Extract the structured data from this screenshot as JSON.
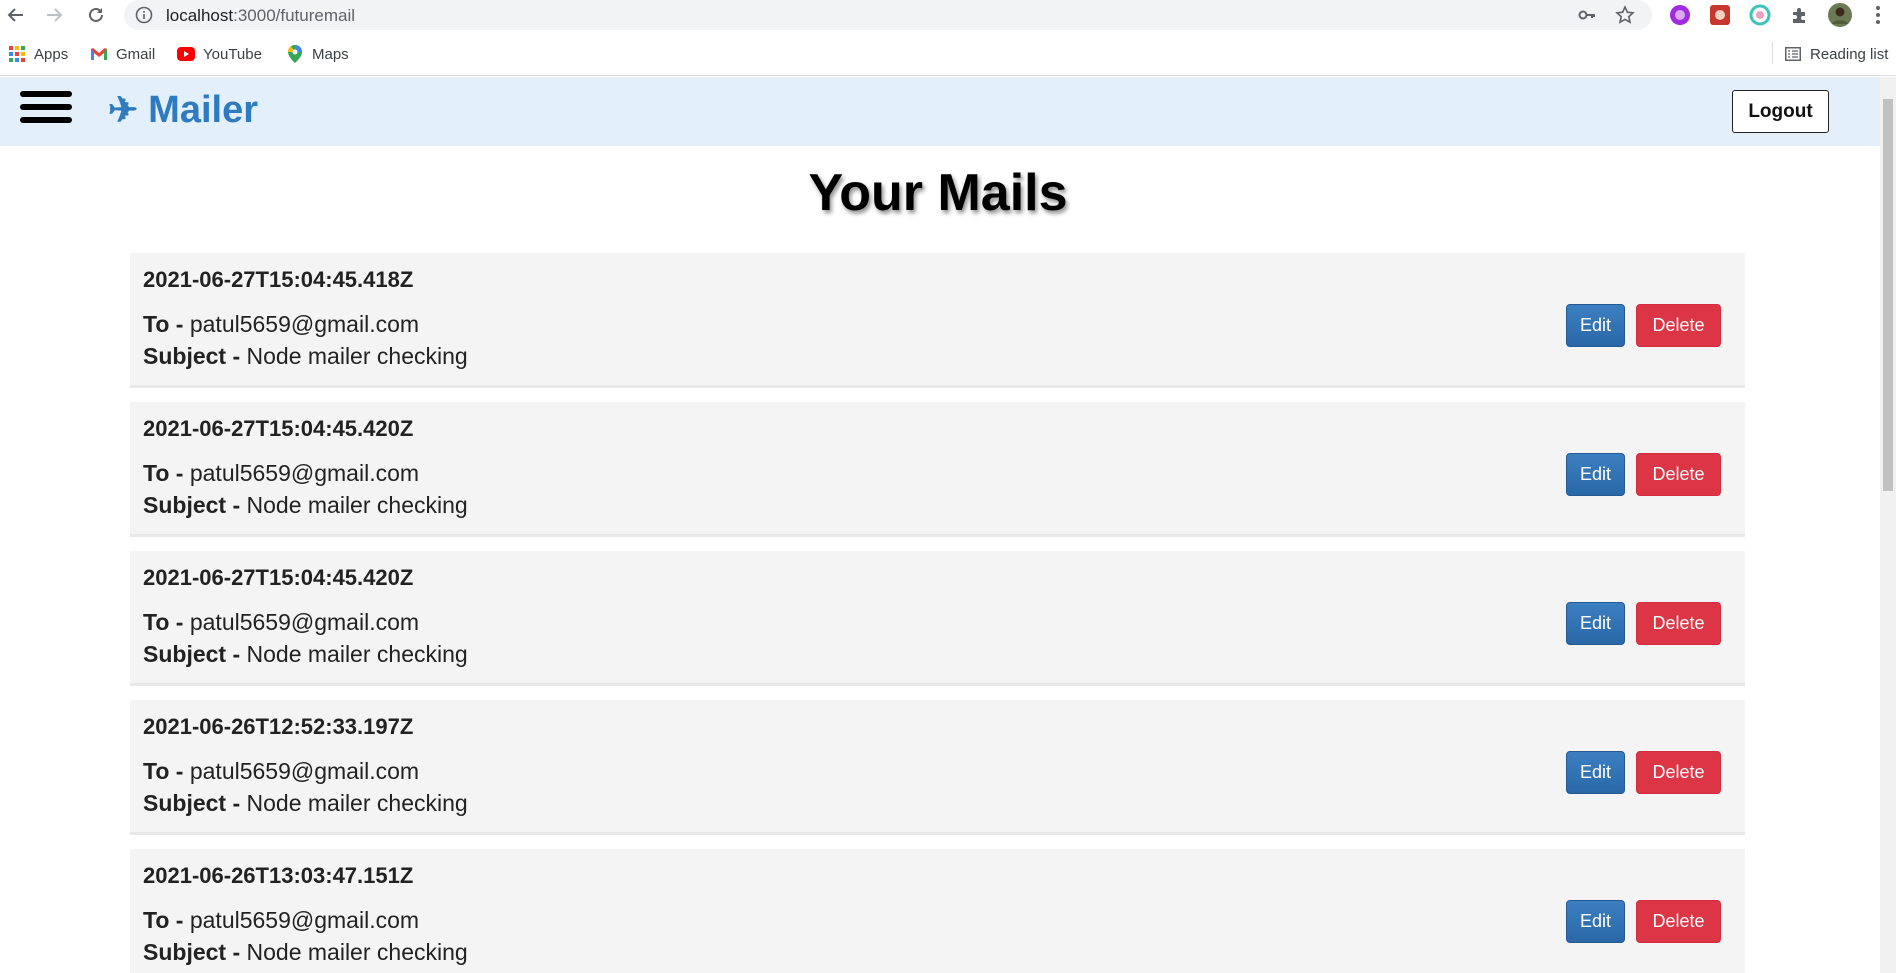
{
  "browser": {
    "url_host": "localhost",
    "url_path": ":3000/futuremail",
    "bookmarks": [
      {
        "label": "Apps",
        "icon": "apps-grid-icon"
      },
      {
        "label": "Gmail",
        "icon": "gmail-icon"
      },
      {
        "label": "YouTube",
        "icon": "youtube-icon"
      },
      {
        "label": "Maps",
        "icon": "maps-icon"
      }
    ],
    "reading_list": "Reading list"
  },
  "header": {
    "brand_icon": "✈",
    "brand": "Mailer",
    "logout_label": "Logout"
  },
  "page_title": "Your Mails",
  "mail_labels": {
    "to": "To -",
    "subject": "Subject -",
    "edit": "Edit",
    "delete": "Delete"
  },
  "mails": [
    {
      "date": "2021-06-27T15:04:45.418Z",
      "to": "patul5659@gmail.com",
      "subject": "Node mailer checking"
    },
    {
      "date": "2021-06-27T15:04:45.420Z",
      "to": "patul5659@gmail.com",
      "subject": "Node mailer checking"
    },
    {
      "date": "2021-06-27T15:04:45.420Z",
      "to": "patul5659@gmail.com",
      "subject": "Node mailer checking"
    },
    {
      "date": "2021-06-26T12:52:33.197Z",
      "to": "patul5659@gmail.com",
      "subject": "Node mailer checking"
    },
    {
      "date": "2021-06-26T13:03:47.151Z",
      "to": "patul5659@gmail.com",
      "subject": "Node mailer checking"
    }
  ],
  "colors": {
    "header_bg": "#e3f0fb",
    "brand": "#2f7bbf",
    "edit_button": "#2a68a7",
    "delete_button": "#dc3545",
    "card_bg": "#f4f4f4"
  }
}
